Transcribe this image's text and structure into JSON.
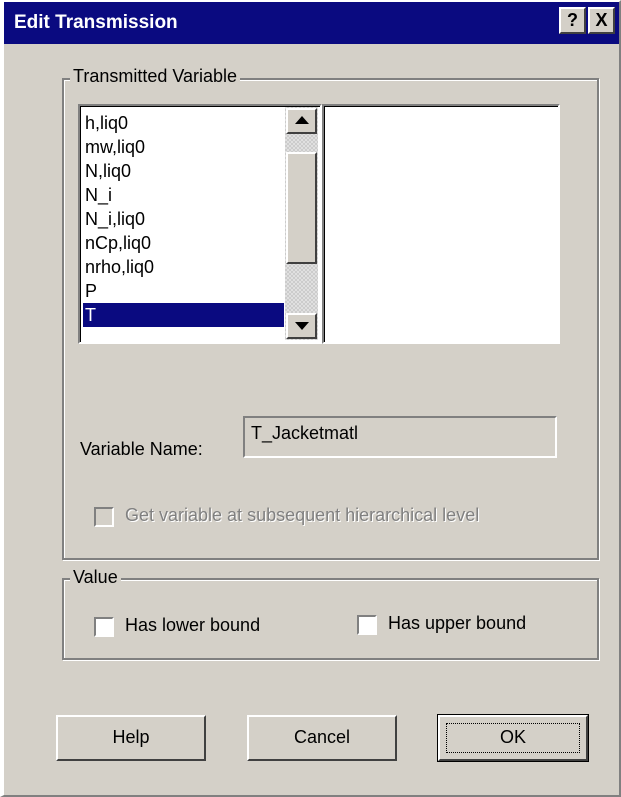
{
  "window": {
    "title": "Edit Transmission",
    "help_glyph": "?",
    "close_glyph": "X"
  },
  "transmitted_group": {
    "legend": "Transmitted Variable",
    "variables": [
      "h,liq0",
      "mw,liq0",
      "N,liq0",
      "N_i",
      "N_i,liq0",
      "nCp,liq0",
      "nrho,liq0",
      "P",
      "T"
    ],
    "selected": "T",
    "variable_name_label": "Variable Name:",
    "variable_name_value": "T_Jacketmatl",
    "subsequent_level_label": "Get variable at subsequent hierarchical level",
    "subsequent_level_checked": false,
    "subsequent_level_enabled": false
  },
  "value_group": {
    "legend": "Value",
    "lower_bound_label": "Has lower bound",
    "lower_bound_checked": false,
    "upper_bound_label": "Has upper bound",
    "upper_bound_checked": false
  },
  "buttons": {
    "help": "Help",
    "cancel": "Cancel",
    "ok": "OK"
  },
  "colors": {
    "titlebar": "#0a0a80",
    "face": "#d4d0c8",
    "selection": "#0a0a80"
  }
}
